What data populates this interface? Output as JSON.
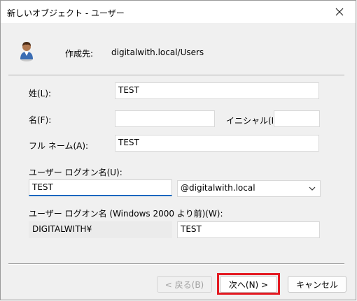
{
  "window": {
    "title": "新しいオブジェクト - ユーザー",
    "close_glyph": "✕"
  },
  "destination": {
    "label": "作成先:",
    "value": "digitalwith.local/Users",
    "icon": "user-icon"
  },
  "form": {
    "last_name_label": "姓(L):",
    "last_name_value": "TEST",
    "first_name_label": "名(F):",
    "first_name_value": "",
    "initials_label": "イニシャル(I):",
    "initials_value": "",
    "full_name_label": "フル ネーム(A):",
    "full_name_value": "TEST",
    "logon_name_label": "ユーザー ログオン名(U):",
    "logon_name_value": "TEST",
    "domain_selected": "@digitalwith.local",
    "pre2000_label": "ユーザー ログオン名 (Windows 2000 より前)(W):",
    "pre2000_domain": "DIGITALWITH¥",
    "pre2000_value": "TEST"
  },
  "buttons": {
    "back": "< 戻る(B)",
    "next": "次へ(N) >",
    "cancel": "キャンセル"
  },
  "colors": {
    "highlight": "#e41b23",
    "focus": "#0067c0"
  }
}
